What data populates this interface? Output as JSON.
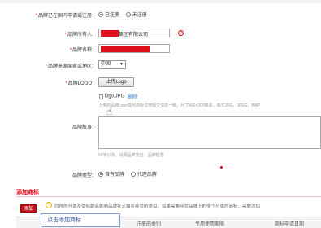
{
  "registered_in_china": {
    "label": "品牌已在国内申请或注册：",
    "options": [
      {
        "label": "已注册",
        "selected": true
      },
      {
        "label": "未注册",
        "selected": false
      }
    ]
  },
  "brand_owner": {
    "label": "品牌所有人：",
    "value_suffix": "集团有限公司"
  },
  "brand_name": {
    "label": "品牌名称："
  },
  "origin": {
    "label": "品牌来源国家或地区：",
    "value": "中国"
  },
  "logo": {
    "label": "品牌LOGO：",
    "upload_label": "上传Logo",
    "file_name": "logo.JPG",
    "delete_label": "删除",
    "hint": "上传的品牌Logo需与商标注册图文信息一致，尺寸400×200像素，格式JPG，JPEG，BMP"
  },
  "story": {
    "label": "品牌故事：",
    "hint": "50字以内，说明品牌定位、品牌理念"
  },
  "brand_type": {
    "label": "品牌类型：",
    "options": [
      {
        "label": "自有品牌",
        "selected": true
      },
      {
        "label": "代理品牌",
        "selected": false
      }
    ]
  },
  "add_trademark": {
    "section_title": "添加商标",
    "tip": "同样的分类及类似群会影响品牌在天猫可经营的类目，如果需要经营品牌下的多个分类的商标，需要添加",
    "add_button": "添加",
    "callout": "点击添加商标",
    "columns": [
      "注册的类别",
      "专用使用期限",
      "商标申请日期"
    ]
  },
  "colors": {
    "accent": "#e60012",
    "link": "#2b78c5"
  }
}
